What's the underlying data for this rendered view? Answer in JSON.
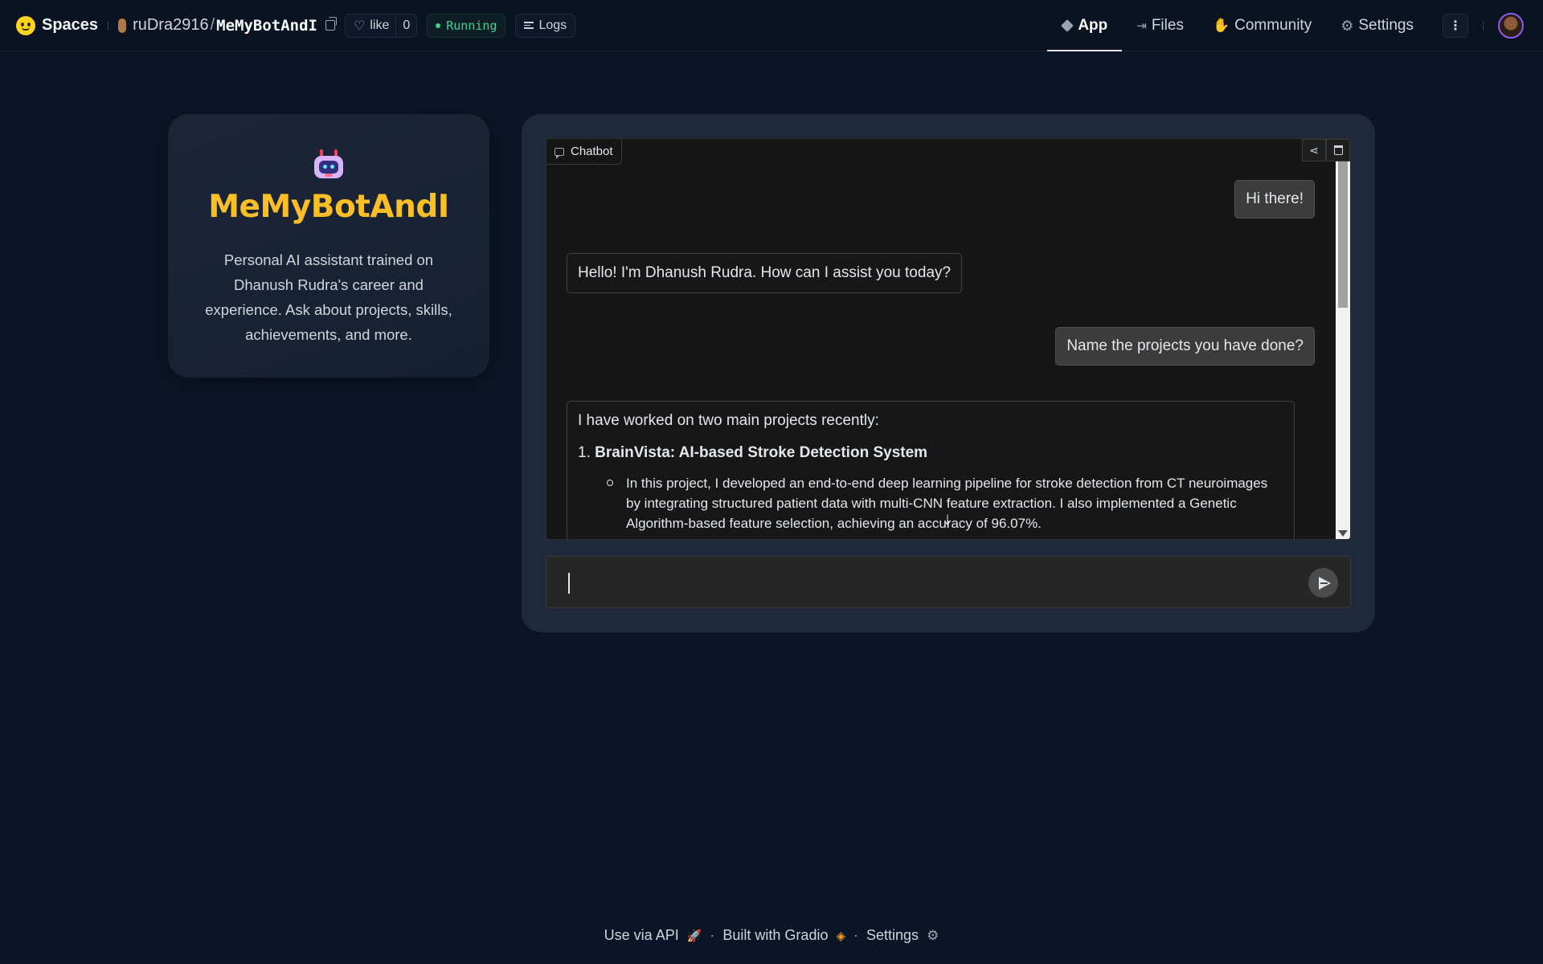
{
  "topbar": {
    "brand": "Spaces",
    "owner": "ruDra2916",
    "slash": "/",
    "repo": "MeMyBotAndI",
    "like_label": "like",
    "like_count": "0",
    "status": "Running",
    "logs_label": "Logs",
    "tabs": [
      {
        "label": "App",
        "icon": "cube-icon",
        "active": true
      },
      {
        "label": "Files",
        "icon": "files-icon",
        "active": false
      },
      {
        "label": "Community",
        "icon": "community-icon",
        "active": false
      },
      {
        "label": "Settings",
        "icon": "gear-icon",
        "active": false
      }
    ],
    "more": "⋮"
  },
  "profile": {
    "title": "MeMyBotAndI",
    "description": "Personal AI assistant trained on Dhanush Rudra's career and experience. Ask about projects, skills, achievements, and more."
  },
  "chat": {
    "label": "Chatbot",
    "messages": [
      {
        "role": "user",
        "text": "Hi there!"
      },
      {
        "role": "bot",
        "text": "Hello! I'm Dhanush Rudra. How can I assist you today?"
      },
      {
        "role": "user",
        "text": "Name the projects you have done?"
      },
      {
        "role": "bot",
        "intro": "I have worked on two main projects recently:",
        "project_num": "1.",
        "project_title": "BrainVista: AI-based Stroke Detection System",
        "detail": "In this project, I developed an end-to-end deep learning pipeline for stroke detection from CT neuroimages by integrating structured patient data with multi-CNN feature extraction. I also implemented a Genetic Algorithm-based feature selection, achieving an accuracy of 96.07%."
      }
    ],
    "input_value": ""
  },
  "footer": {
    "api": "Use via API",
    "built": "Built with Gradio",
    "settings": "Settings",
    "dot": "·"
  },
  "colors": {
    "background": "#0c1427",
    "accent_title": "#fbbf24",
    "status_green": "#34d399"
  }
}
